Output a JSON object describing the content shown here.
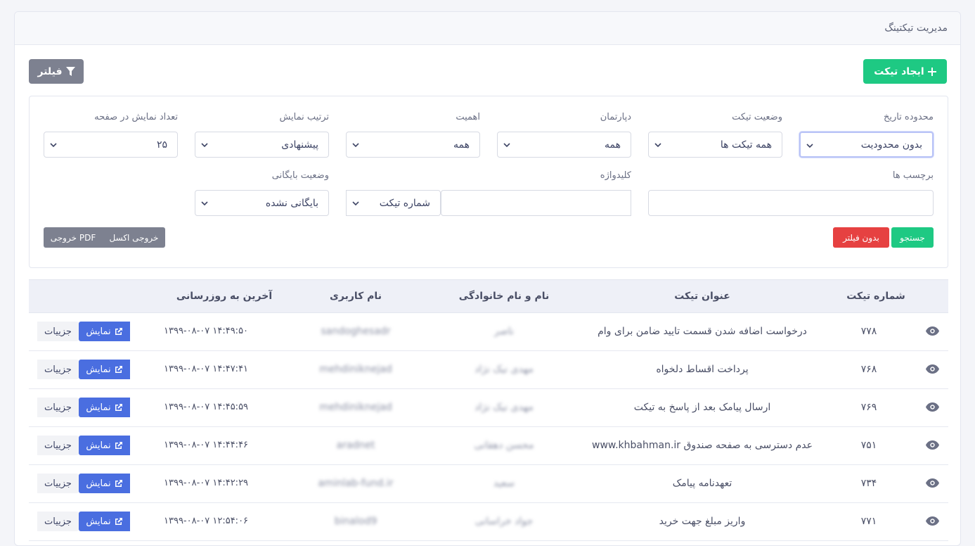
{
  "header": {
    "title": "مدیریت تیکتینگ"
  },
  "toolbar": {
    "create_label": "ایجاد تیکت",
    "filter_label": "فیلتر"
  },
  "filters": {
    "date_range": {
      "label": "محدوده تاریخ",
      "value": "بدون محدودیت"
    },
    "status": {
      "label": "وضعیت تیکت",
      "value": "همه تیکت ها"
    },
    "department": {
      "label": "دپارتمان",
      "value": "همه"
    },
    "priority": {
      "label": "اهمیت",
      "value": "همه"
    },
    "sort": {
      "label": "ترتیب نمایش",
      "value": "پیشنهادی"
    },
    "per_page": {
      "label": "تعداد نمایش در صفحه",
      "value": "۲۵"
    },
    "tags": {
      "label": "برچسب ها",
      "value": ""
    },
    "keyword": {
      "label": "کلیدواژه",
      "value": "",
      "type_value": "شماره تیکت"
    },
    "archive": {
      "label": "وضعیت بایگانی",
      "value": "بایگانی نشده"
    },
    "search_label": "جستجو",
    "clear_label": "بدون فیلتر",
    "excel_label": "خروجی اکسل",
    "pdf_label": "خروجی PDF"
  },
  "table": {
    "headers": {
      "number": "شماره تیکت",
      "title": "عنوان تیکت",
      "name": "نام و نام خانوادگی",
      "username": "نام کاربری",
      "updated": "آخرین به روزرسانی"
    },
    "show_label": "نمایش",
    "detail_label": "جزییات",
    "rows": [
      {
        "number": "۷۷۸",
        "title": "درخواست اضافه شدن قسمت تایید ضامن برای وام",
        "name": "ناصر",
        "username": "sandoghesadr",
        "updated": "۱۳۹۹-۰۸-۰۷ ۱۴:۴۹:۵۰"
      },
      {
        "number": "۷۶۸",
        "title": "پرداخت اقساط دلخواه",
        "name": "مهدی نیک نژاد",
        "username": "mehdiniknejad",
        "updated": "۱۳۹۹-۰۸-۰۷ ۱۴:۴۷:۴۱"
      },
      {
        "number": "۷۶۹",
        "title": "ارسال پیامک بعد از پاسخ به تیکت",
        "name": "مهدی نیک نژاد",
        "username": "mehdiniknejad",
        "updated": "۱۳۹۹-۰۸-۰۷ ۱۴:۴۵:۵۹"
      },
      {
        "number": "۷۵۱",
        "title": "عدم دسترسی به صفحه صندوق www.khbahman.ir",
        "name": "محسن دهقانی",
        "username": "aradnet",
        "updated": "۱۳۹۹-۰۸-۰۷ ۱۴:۴۴:۴۶"
      },
      {
        "number": "۷۳۴",
        "title": "تعهدنامه پیامک",
        "name": "سعید",
        "username": "aminlab-fund.ir",
        "updated": "۱۳۹۹-۰۸-۰۷ ۱۴:۴۲:۲۹"
      },
      {
        "number": "۷۷۱",
        "title": "واریز مبلغ جهت خرید",
        "name": "جواد خراسانی",
        "username": "binalod9",
        "updated": "۱۳۹۹-۰۸-۰۷ ۱۲:۵۴:۰۶"
      }
    ]
  }
}
